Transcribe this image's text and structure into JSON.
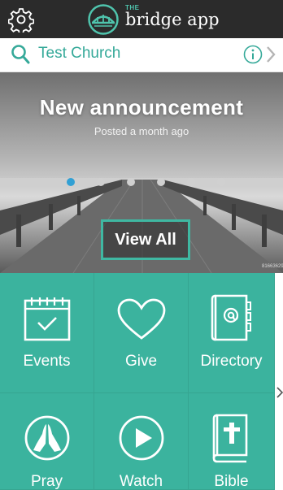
{
  "header": {
    "brand_small": "THE",
    "brand_name": "bridge app",
    "icons": {
      "settings": "gear-icon",
      "logo": "bridge-logo-icon"
    }
  },
  "church_bar": {
    "church_name": "Test Church",
    "icons": {
      "search": "search-icon",
      "info": "info-icon",
      "next": "chevron-right-icon"
    }
  },
  "hero": {
    "title": "New announcement",
    "subtitle": "Posted a month ago",
    "button_label": "View All",
    "watermark": "81663629",
    "slide_count": 6,
    "active_slide": 0
  },
  "tiles": [
    {
      "label": "Events",
      "icon": "calendar-icon"
    },
    {
      "label": "Give",
      "icon": "heart-icon"
    },
    {
      "label": "Directory",
      "icon": "address-book-icon"
    },
    {
      "label": "Pray",
      "icon": "praying-hands-icon"
    },
    {
      "label": "Watch",
      "icon": "play-icon"
    },
    {
      "label": "Bible",
      "icon": "bible-icon"
    }
  ],
  "colors": {
    "accent": "#3bb39e",
    "header_bg": "#2b2b2b",
    "link": "#35a999",
    "dot_active": "#31a0d4"
  }
}
